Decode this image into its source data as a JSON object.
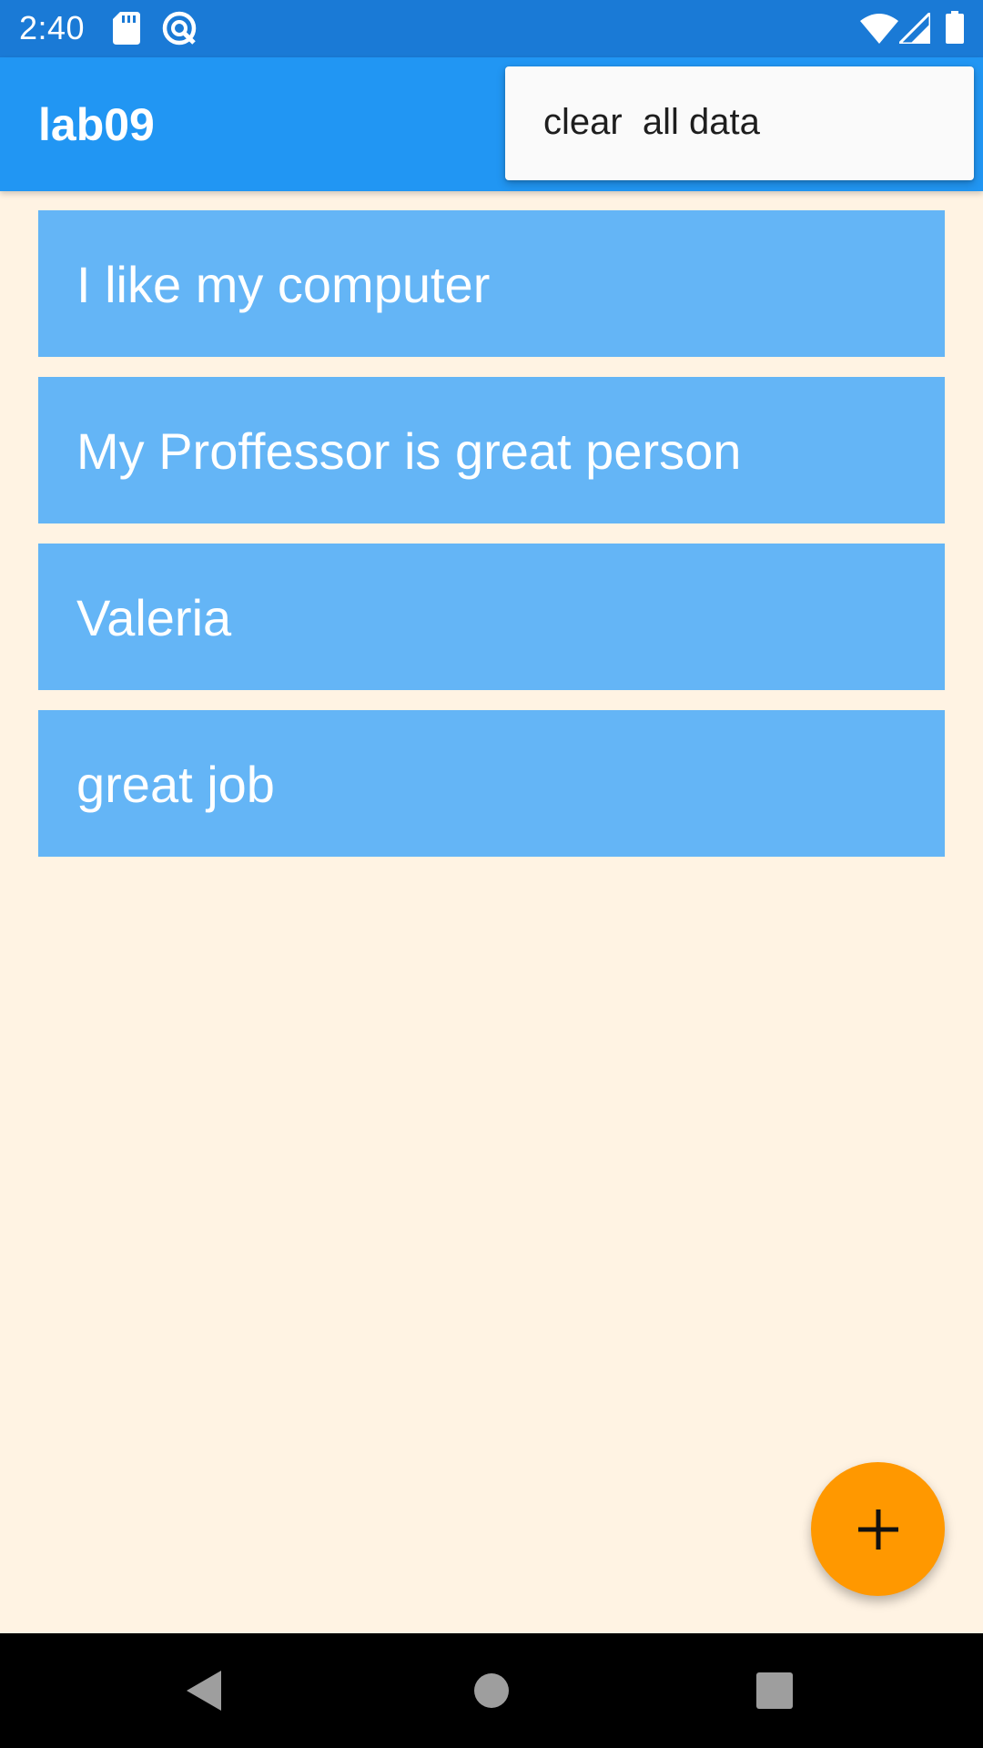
{
  "status_bar": {
    "time": "2:40",
    "icons": [
      "sd-card-icon",
      "sync-icon",
      "wifi-icon",
      "signal-icon",
      "battery-icon"
    ]
  },
  "app_bar": {
    "title": "lab09"
  },
  "menu": {
    "items": [
      {
        "label": "clear  all data"
      }
    ]
  },
  "notes": [
    {
      "text": "I like my computer"
    },
    {
      "text": "My Proffessor is great person"
    },
    {
      "text": "Valeria"
    },
    {
      "text": "great job"
    }
  ],
  "fab": {
    "icon": "add-icon"
  },
  "nav_bar": {
    "buttons": [
      "back-icon",
      "home-icon",
      "recents-icon"
    ]
  },
  "colors": {
    "status_bar": "#1A7AD6",
    "app_bar": "#2196F3",
    "background": "#FFF3E3",
    "list_item": "#64B5F6",
    "fab": "#FF9800",
    "menu": "#FAFAFA"
  }
}
